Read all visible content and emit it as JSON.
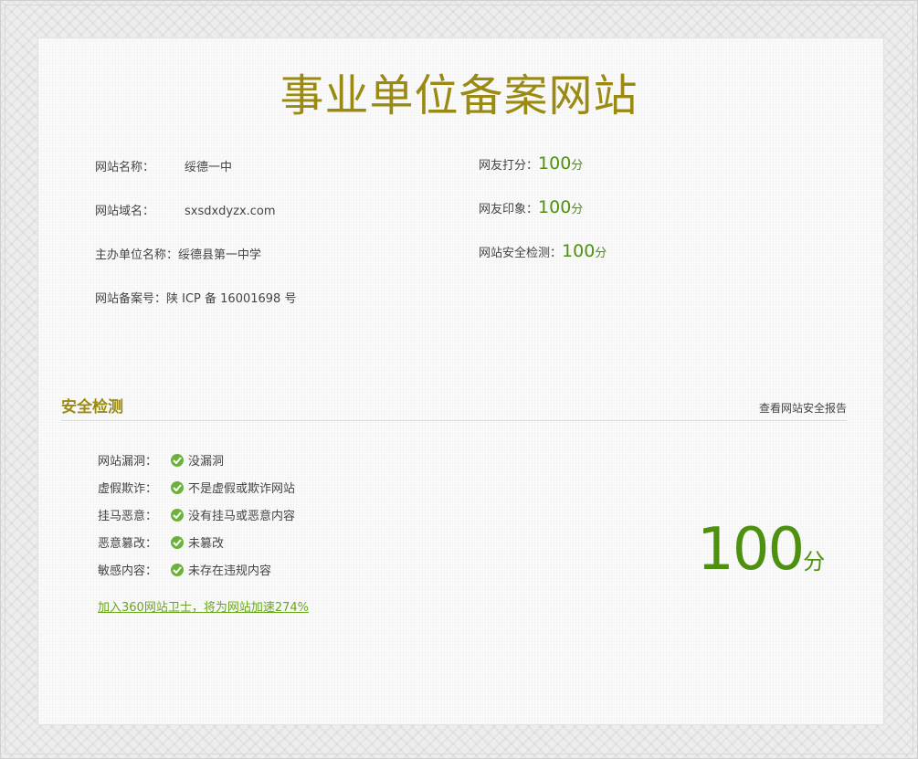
{
  "page_title": "事业单位备案网站",
  "site_info": [
    {
      "label": "网站名称：",
      "value": "绥德一中"
    },
    {
      "label": "网站域名：",
      "value": "sxsdxdyzx.com"
    },
    {
      "label": "主办单位名称：",
      "value": "绥德县第一中学"
    },
    {
      "label": "网站备案号：",
      "value": "陕 ICP 备 16001698 号"
    }
  ],
  "scores": [
    {
      "label": "网友打分：",
      "value": "100",
      "unit": "分"
    },
    {
      "label": "网友印象：",
      "value": "100",
      "unit": "分"
    },
    {
      "label": "网站安全检测：",
      "value": "100",
      "unit": "分"
    }
  ],
  "security": {
    "title": "安全检测",
    "report_link": "查看网站安全报告",
    "items": [
      {
        "label": "网站漏洞：",
        "value": "没漏洞",
        "icon": "check-circle-icon"
      },
      {
        "label": "虚假欺诈：",
        "value": "不是虚假或欺诈网站",
        "icon": "check-circle-icon"
      },
      {
        "label": "挂马恶意：",
        "value": "没有挂马或恶意内容",
        "icon": "check-circle-icon"
      },
      {
        "label": "恶意篡改：",
        "value": "未篡改",
        "icon": "check-circle-icon"
      },
      {
        "label": "敏感内容：",
        "value": "未存在违规内容",
        "icon": "check-circle-icon"
      }
    ],
    "join_link": "加入360网站卫士，将为网站加速274%",
    "total_score": "100",
    "total_unit": "分"
  },
  "colors": {
    "title": "#9a8a12",
    "score": "#4e9010",
    "check": "#6cb23a",
    "link": "#6aa61c"
  }
}
